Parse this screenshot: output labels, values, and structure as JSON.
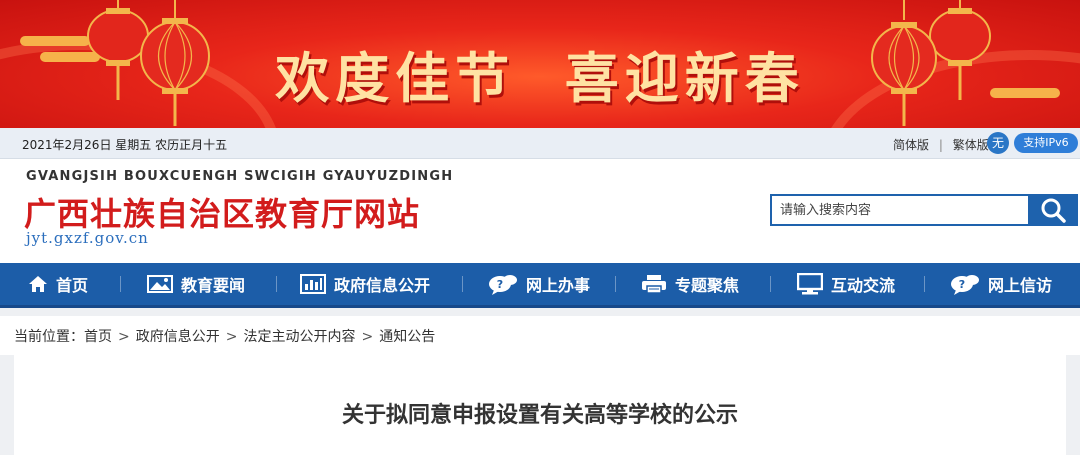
{
  "banner": {
    "slogan": "欢度佳节  喜迎新春"
  },
  "topbar": {
    "date": "2021年2月26日 星期五 农历正月十五",
    "simplified": "简体版",
    "separator": "|",
    "traditional": "繁体版",
    "icon_text": "无",
    "ipv6": "支持IPv6"
  },
  "header": {
    "site_name_en": "GVANGJSIH BOUXCUENGH SWCIGIH GYAUYUZDINGH",
    "site_name": "广西壮族自治区教育厅网站",
    "site_url": "jyt.gxzf.gov.cn",
    "search_placeholder": "请输入搜索内容"
  },
  "nav": [
    {
      "label": "首页",
      "icon": "home-icon"
    },
    {
      "label": "教育要闻",
      "icon": "image-icon"
    },
    {
      "label": "政府信息公开",
      "icon": "bar-chart-icon"
    },
    {
      "label": "网上办事",
      "icon": "chat-bubble-icon"
    },
    {
      "label": "专题聚焦",
      "icon": "printer-icon"
    },
    {
      "label": "互动交流",
      "icon": "monitor-icon"
    },
    {
      "label": "网上信访",
      "icon": "chat-bubble-icon"
    }
  ],
  "breadcrumb": {
    "prefix": "当前位置：",
    "items": [
      "首页",
      "政府信息公开",
      "法定主动公开内容",
      "通知公告"
    ],
    "arrow": ">"
  },
  "article": {
    "title": "关于拟同意申报设置有关高等学校的公示"
  },
  "colors": {
    "nav_bg": "#1c5da8",
    "site_name": "#d21c1c",
    "banner_red": "#e8261a",
    "slogan": "#ffe2a3"
  }
}
